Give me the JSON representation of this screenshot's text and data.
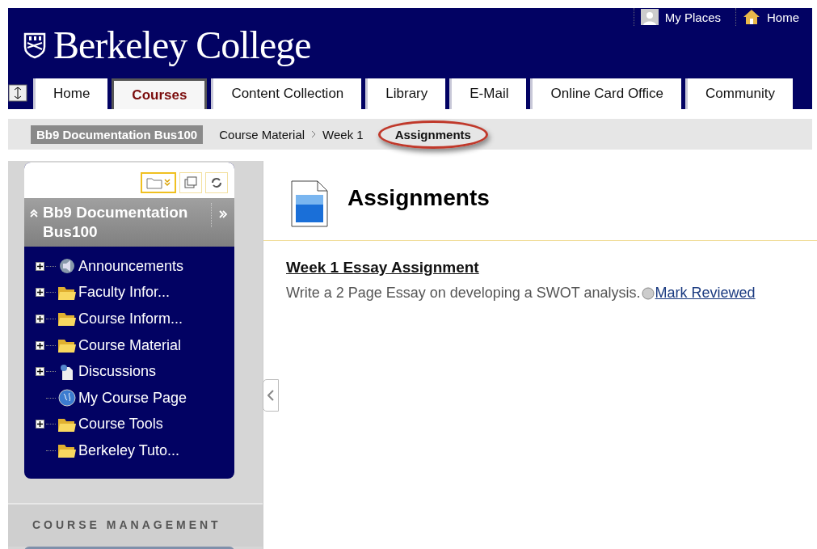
{
  "header": {
    "logo": "Berkeley College",
    "links": [
      {
        "label": "My Places",
        "kind": "person"
      },
      {
        "label": "Home",
        "kind": "house"
      }
    ]
  },
  "tabs": [
    {
      "label": "Home",
      "selected": false
    },
    {
      "label": "Courses",
      "selected": true
    },
    {
      "label": "Content Collection",
      "selected": false
    },
    {
      "label": "Library",
      "selected": false
    },
    {
      "label": "E-Mail",
      "selected": false
    },
    {
      "label": "Online Card Office",
      "selected": false
    },
    {
      "label": "Community",
      "selected": false
    }
  ],
  "breadcrumb": {
    "course": "Bb9 Documentation Bus100",
    "items": [
      {
        "label": "Course Material",
        "current": false
      },
      {
        "label": "Week 1",
        "current": false
      },
      {
        "label": "Assignments",
        "current": true
      }
    ]
  },
  "sidebar": {
    "title": "Bb9 Documentation Bus100",
    "items": [
      {
        "label": "Announcements",
        "kind": "megaphone",
        "expandable": true
      },
      {
        "label": "Faculty Infor...",
        "kind": "folder",
        "expandable": true
      },
      {
        "label": "Course Inform...",
        "kind": "folder",
        "expandable": true
      },
      {
        "label": "Course Material",
        "kind": "folder",
        "expandable": true
      },
      {
        "label": "Discussions",
        "kind": "discussion",
        "expandable": true
      },
      {
        "label": "My Course Page",
        "kind": "globe",
        "expandable": false
      },
      {
        "label": "Course Tools",
        "kind": "folder",
        "expandable": true
      },
      {
        "label": "Berkeley Tuto...",
        "kind": "folder",
        "expandable": false
      }
    ],
    "management_heading": "COURSE MANAGEMENT"
  },
  "content": {
    "title": "Assignments",
    "items": [
      {
        "title": "Week 1 Essay Assignment",
        "description": "Write a 2 Page Essay on developing a SWOT analysis.",
        "action": "Mark Reviewed"
      }
    ]
  }
}
